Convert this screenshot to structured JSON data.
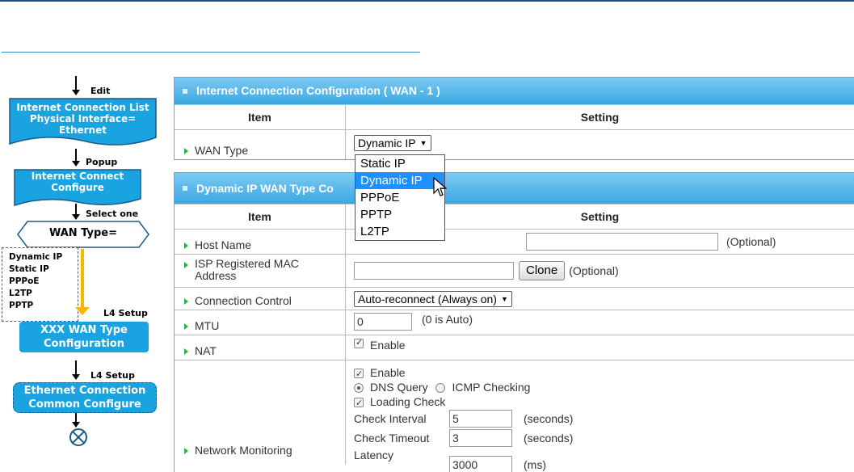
{
  "flowchart": {
    "edit_label": "Edit",
    "list_box": [
      "Internet Connection List",
      "Physical Interface=",
      "Ethernet"
    ],
    "popup_label": "Popup",
    "configure_box": [
      "Internet Connect",
      "Configure"
    ],
    "select_label": "Select one",
    "wan_type_decision": "WAN Type=",
    "wan_type_options": [
      "Dynamic IP",
      "Static IP",
      "PPPoE",
      "L2TP",
      "PPTP"
    ],
    "l4_setup_label_1": "L4 Setup",
    "xxx_box": [
      "XXX WAN Type",
      "Configuration"
    ],
    "l4_setup_label_2": "L4 Setup",
    "common_box": [
      "Ethernet Connection",
      "Common Configure"
    ],
    "colors": {
      "box_blue": "#19a3e0",
      "arrow_yellow": "#f5b800"
    }
  },
  "panel1": {
    "title": "Internet Connection Configuration ( WAN - 1 )",
    "col_item": "Item",
    "col_setting": "Setting",
    "wan_type_label": "WAN Type",
    "wan_type_value": "Dynamic IP"
  },
  "dropdown": {
    "options": [
      "Static IP",
      "Dynamic IP",
      "PPPoE",
      "PPTP",
      "L2TP"
    ],
    "selected": "Dynamic IP"
  },
  "panel2": {
    "title": "Dynamic IP WAN Type Co",
    "col_item": "Item",
    "col_setting": "Setting",
    "host_name_label": "Host Name",
    "host_name_value": "",
    "host_name_hint": "(Optional)",
    "mac_label": "ISP Registered MAC Address",
    "mac_value": "",
    "clone_button": "Clone",
    "mac_hint": "(Optional)",
    "conn_control_label": "Connection Control",
    "conn_control_value": "Auto-reconnect (Always on)",
    "mtu_label": "MTU",
    "mtu_value": "0",
    "mtu_hint": "(0 is Auto)",
    "nat_label": "NAT",
    "nat_enable": "Enable",
    "netmon_label": "Network Monitoring",
    "netmon_enable": "Enable",
    "dns_query": "DNS Query",
    "icmp_checking": "ICMP Checking",
    "loading_check": "Loading Check",
    "check_interval_label": "Check Interval",
    "check_interval_value": "5",
    "check_interval_unit": "(seconds)",
    "check_timeout_label": "Check Timeout",
    "check_timeout_value": "3",
    "check_timeout_unit": "(seconds)",
    "latency_label": "Latency",
    "latency_value": "3000",
    "latency_unit": "(ms)"
  },
  "colors": {
    "header_blue": "#3aa8e4",
    "select_highlight": "#1e90ff",
    "row_marker": "#2bb24c"
  }
}
